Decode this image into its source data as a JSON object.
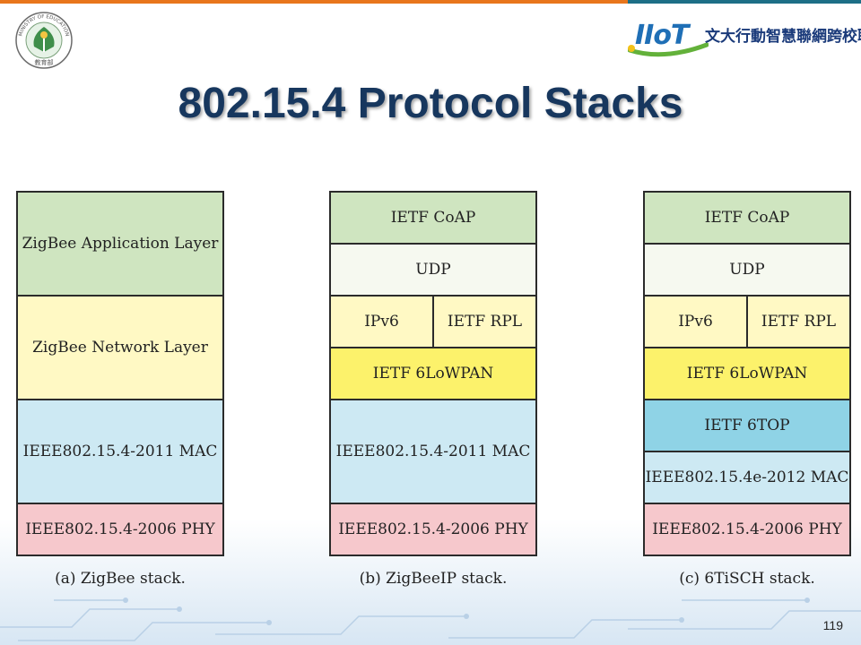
{
  "header": {
    "moe_logo_text": "MINISTRY OF EDUCATION",
    "moe_logo_cn": "教育部",
    "brand_logo_text": "IIoT",
    "brand_cn": "文大行動智慧聯網跨校聯盟"
  },
  "title": "802.15.4 Protocol Stacks",
  "colors": {
    "green": "#cfe5c0",
    "white": "#f6f9f0",
    "yellow_light": "#fff9c4",
    "yellow": "#fcf26b",
    "blue_light": "#cde9f3",
    "blue": "#8fd3e6",
    "pink": "#f6c8cc"
  },
  "stacks": [
    {
      "caption": "(a) ZigBee stack.",
      "layers": [
        {
          "label": "ZigBee Application Layer"
        },
        {
          "label": "ZigBee Network Layer"
        },
        {
          "label": "IEEE802.15.4-2011 MAC"
        },
        {
          "label": "IEEE802.15.4-2006 PHY"
        }
      ]
    },
    {
      "caption": "(b) ZigBeeIP stack.",
      "layers": [
        {
          "label": "IETF CoAP"
        },
        {
          "label": "UDP"
        },
        {
          "left": "IPv6",
          "right": "IETF RPL"
        },
        {
          "label": "IETF 6LoWPAN"
        },
        {
          "label": "IEEE802.15.4-2011 MAC"
        },
        {
          "label": "IEEE802.15.4-2006 PHY"
        }
      ]
    },
    {
      "caption": "(c) 6TiSCH stack.",
      "layers": [
        {
          "label": "IETF CoAP"
        },
        {
          "label": "UDP"
        },
        {
          "left": "IPv6",
          "right": "IETF RPL"
        },
        {
          "label": "IETF 6LoWPAN"
        },
        {
          "label": "IETF 6TOP"
        },
        {
          "label": "IEEE802.15.4e-2012 MAC"
        },
        {
          "label": "IEEE802.15.4-2006 PHY"
        }
      ]
    }
  ],
  "page_number": "119"
}
